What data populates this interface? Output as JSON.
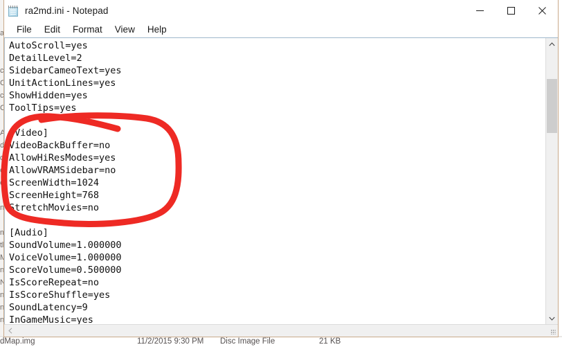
{
  "window": {
    "title": "ra2md.ini - Notepad",
    "icon": "notepad-icon",
    "controls": {
      "minimize": "minimize-icon",
      "maximize": "maximize-icon",
      "close": "close-icon"
    }
  },
  "menu": {
    "items": [
      {
        "label": "File"
      },
      {
        "label": "Edit"
      },
      {
        "label": "Format"
      },
      {
        "label": "View"
      },
      {
        "label": "Help"
      }
    ]
  },
  "editor": {
    "text": "AutoScroll=yes\nDetailLevel=2\nSidebarCameoText=yes\nUnitActionLines=yes\nShowHidden=yes\nToolTips=yes\n\n[Video]\nVideoBackBuffer=no\nAllowHiResModes=yes\nAllowVRAMSidebar=no\nScreenWidth=1024\nScreenHeight=768\nStretchMovies=no\n\n[Audio]\nSoundVolume=1.000000\nVoiceVolume=1.000000\nScoreVolume=0.500000\nIsScoreRepeat=no\nIsScoreShuffle=yes\nSoundLatency=9\nInGameMusic=yes",
    "lines": [
      "AutoScroll=yes",
      "DetailLevel=2",
      "SidebarCameoText=yes",
      "UnitActionLines=yes",
      "ShowHidden=yes",
      "ToolTips=yes",
      "",
      "[Video]",
      "VideoBackBuffer=no",
      "AllowHiResModes=yes",
      "AllowVRAMSidebar=no",
      "ScreenWidth=1024",
      "ScreenHeight=768",
      "StretchMovies=no",
      "",
      "[Audio]",
      "SoundVolume=1.000000",
      "VoiceVolume=1.000000",
      "ScoreVolume=0.500000",
      "IsScoreRepeat=no",
      "IsScoreShuffle=yes",
      "SoundLatency=9",
      "InGameMusic=yes"
    ]
  },
  "scrollbars": {
    "vertical": {
      "up_arrow": "chevron-up-icon",
      "down_arrow": "chevron-down-icon"
    },
    "horizontal": {
      "left_arrow": "chevron-left-icon",
      "resize_grip": "resize-grip-icon"
    }
  },
  "annotation": {
    "shape": "hand-drawn-ellipse",
    "color": "#ee2a24",
    "encircles_section": "[Video]"
  },
  "background_explorer": {
    "row": {
      "name": "dMap.img",
      "date": "11/2/2015 9:30 PM",
      "type": "Disc Image File",
      "size": "21 KB"
    },
    "left_fragments": [
      "ag",
      "",
      "",
      "ch",
      "C",
      "ch",
      "C",
      "",
      "A",
      "d",
      "d",
      "o",
      "c",
      "",
      "n",
      "",
      "m",
      "tl",
      "M",
      "n",
      "N",
      "n",
      "n",
      "n"
    ]
  }
}
